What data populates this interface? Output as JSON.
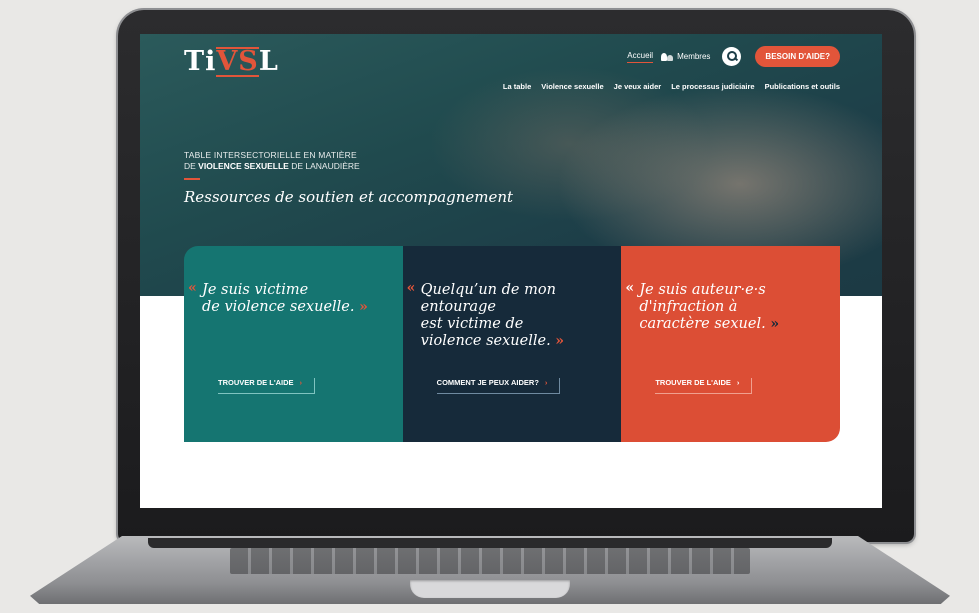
{
  "site": {
    "logo": {
      "text_a": "Ti",
      "text_b": "VS",
      "text_c": "L"
    },
    "topnav": {
      "home": "Accueil",
      "members": "Membres",
      "help_button": "BESOIN D'AIDE?"
    },
    "mainnav": [
      "La table",
      "Violence sexuelle",
      "Je veux aider",
      "Le processus judiciaire",
      "Publications et outils"
    ],
    "tagline": {
      "line1": "TABLE INTERSECTORIELLE EN MATIÈRE",
      "line2_pre": "DE ",
      "line2_bold": "VIOLENCE SEXUELLE",
      "line2_post": " DE LANAUDIÈRE",
      "subtitle": "Ressources de soutien et accompagnement"
    },
    "cards": [
      {
        "quote": "Je suis victime\nde violence sexuelle.",
        "cta": "TROUVER DE L'AIDE"
      },
      {
        "quote": "Quelqu’un de mon\nentourage\nest victime de\nviolence sexuelle.",
        "cta": "COMMENT JE PEUX AIDER?"
      },
      {
        "quote": "Je suis auteur·e·s\nd'infraction à\ncaractère sexuel.",
        "cta": "TROUVER DE L'AIDE"
      }
    ],
    "glyphs": {
      "quote_open": "«",
      "quote_close": "»",
      "arrow": "›"
    },
    "colors": {
      "accent": "#e2553a",
      "teal": "#157571",
      "navy": "#162a3a",
      "orange": "#dc4e35"
    }
  }
}
